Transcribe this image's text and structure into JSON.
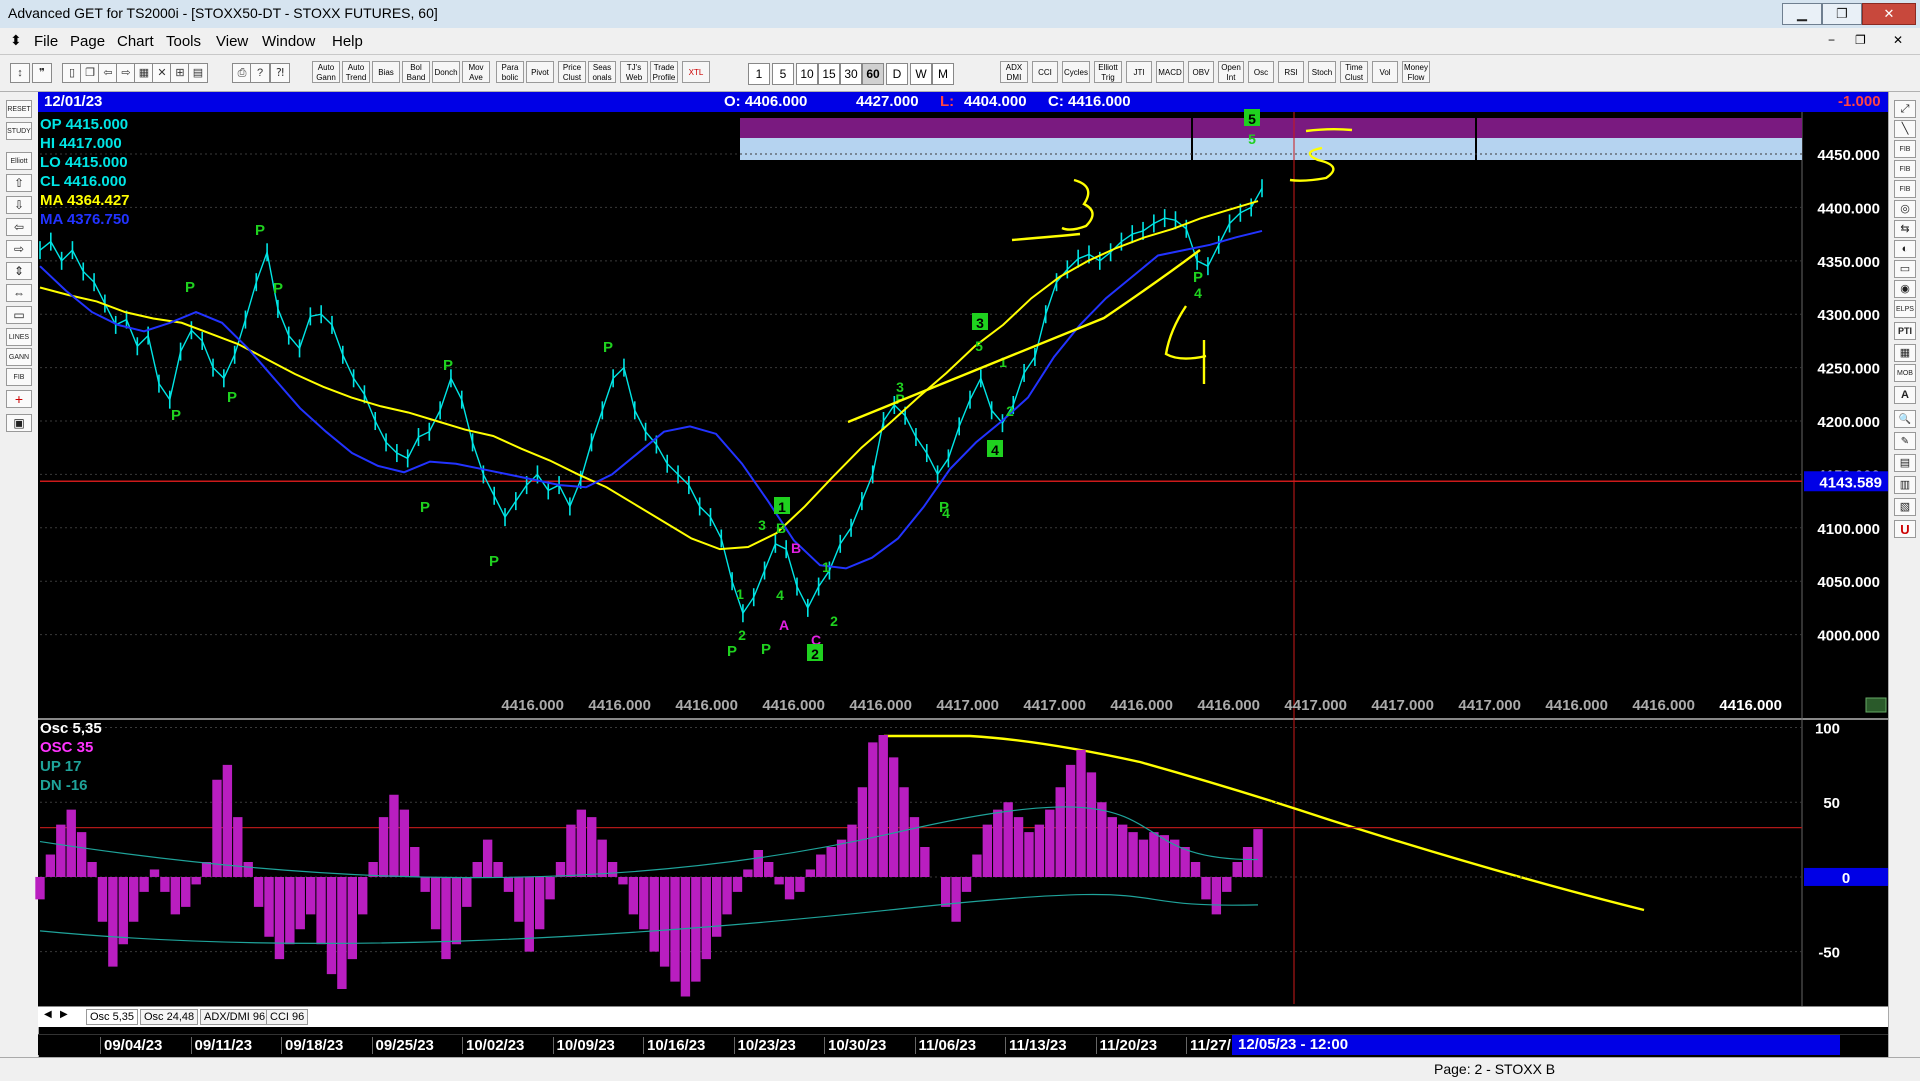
{
  "window": {
    "title": "Advanced GET for TS2000i - [STOXX50-DT - STOXX FUTURES, 60]",
    "minimize": "▁",
    "restore": "❐",
    "close": "✕",
    "mdi_min": "−",
    "mdi_restore": "❐",
    "mdi_close": "✕"
  },
  "menu": [
    "File",
    "Page",
    "Chart",
    "Tools",
    "View",
    "Window",
    "Help"
  ],
  "toolbar": {
    "study_buttons": [
      "Auto Gann",
      "Auto Trend",
      "Bias",
      "Bol Band",
      "Donch",
      "Mov Ave",
      "Para bolic",
      "Pivot",
      "Price Clust",
      "Seas onals",
      "TJ's Web",
      "Trade Profile",
      "XTL"
    ],
    "timeframes": [
      "1",
      "5",
      "10",
      "15",
      "30",
      "60",
      "D",
      "W",
      "M"
    ],
    "active_timeframe": "60",
    "indicator_buttons": [
      "ADX DMI",
      "CCI",
      "Cycles",
      "Elliott Trig",
      "JTI",
      "MACD",
      "OBV",
      "Open Int",
      "Osc",
      "RSI",
      "Stoch",
      "Time Clust",
      "Vol",
      "Money Flow"
    ]
  },
  "left_tools": [
    "RESET",
    "STUDY",
    "Elliott",
    "⇧",
    "⇩",
    "⇦",
    "⇨",
    "⇕",
    "⇔",
    "▭",
    "LINES",
    "GANN",
    "FIB",
    "+",
    "▣"
  ],
  "right_tools": [
    "⤢",
    "╲",
    "FIB RET",
    "FIB EXT",
    "FIB TIME",
    "◎",
    "⇆",
    "◐",
    "▭",
    "◉",
    "ELPS",
    "PTI",
    "▦",
    "MOB",
    "A",
    "🔍",
    "✎",
    "▤",
    "▥",
    "▧",
    "U"
  ],
  "info_bar": {
    "date": "12/01/23",
    "open": "O: 4406.000",
    "high": "4427.000",
    "low_prefix": "L:",
    "low": "4404.000",
    "close": "C: 4416.000",
    "change": "-1.000"
  },
  "readout": [
    {
      "label": "OP  4415.000",
      "color": "#00e5e5"
    },
    {
      "label": "HI   4417.000",
      "color": "#00e5e5"
    },
    {
      "label": "LO  4415.000",
      "color": "#00e5e5"
    },
    {
      "label": "CL   4416.000",
      "color": "#00e5e5"
    },
    {
      "label": "MA  4364.427",
      "color": "#ffff00"
    },
    {
      "label": "MA  4376.750",
      "color": "#2233ff"
    }
  ],
  "oscillator_readout": [
    {
      "label": "Osc 5,35",
      "color": "#ffffff"
    },
    {
      "label": "OSC 35",
      "color": "#ff33ff"
    },
    {
      "label": "UP   17",
      "color": "#1fa39a"
    },
    {
      "label": "DN   -16",
      "color": "#1fa39a"
    }
  ],
  "price_axis": {
    "ticks": [
      "4450.000",
      "4400.000",
      "4350.000",
      "4300.000",
      "4250.000",
      "4200.000",
      "4150.000",
      "4100.000",
      "4050.000",
      "4000.000"
    ],
    "current_marker": "4143.589"
  },
  "osc_axis": {
    "ticks": [
      "100",
      "50",
      "0",
      "-50"
    ]
  },
  "bottom_value_strip": [
    "4416.000",
    "4416.000",
    "4416.000",
    "4416.000",
    "4416.000",
    "4417.000",
    "4417.000",
    "4416.000",
    "4416.000",
    "4417.000",
    "4417.000",
    "4417.000",
    "4416.000",
    "4416.000",
    "4416.000"
  ],
  "tabs": [
    "Osc 5,35",
    "Osc 24,48",
    "ADX/DMI 96",
    "CCI 96"
  ],
  "tab_nav": [
    "◀",
    "▶"
  ],
  "date_axis": [
    "09/04/23",
    "09/11/23",
    "09/18/23",
    "09/25/23",
    "10/02/23",
    "10/09/23",
    "10/16/23",
    "10/23/23",
    "10/30/23",
    "11/06/23",
    "11/13/23",
    "11/20/23",
    "11/27/"
  ],
  "date_cursor": "12/05/23 - 12:00",
  "status": {
    "page": "Page: 2 - STOXX B"
  },
  "chart_data": {
    "type": "line",
    "title": "STOXX50-DT - STOXX FUTURES, 60",
    "xlabel": "",
    "ylabel": "",
    "x_range": [
      "09/04/23",
      "12/05/23"
    ],
    "ylim": [
      3950,
      4480
    ],
    "series": [
      {
        "color": "#00e5e5",
        "type": "price_bars",
        "values": [
          4360,
          4368,
          4350,
          4360,
          4340,
          4330,
          4310,
          4290,
          4295,
          4270,
          4280,
          4235,
          4220,
          4265,
          4285,
          4275,
          4250,
          4240,
          4262,
          4295,
          4330,
          4358,
          4305,
          4280,
          4268,
          4298,
          4300,
          4290,
          4262,
          4240,
          4225,
          4200,
          4180,
          4170,
          4165,
          4185,
          4190,
          4210,
          4240,
          4220,
          4180,
          4150,
          4130,
          4110,
          4125,
          4140,
          4150,
          4135,
          4140,
          4120,
          4145,
          4180,
          4210,
          4240,
          4250,
          4210,
          4190,
          4178,
          4160,
          4150,
          4140,
          4120,
          4110,
          4090,
          4050,
          4020,
          4035,
          4060,
          4085,
          4080,
          4045,
          4025,
          4045,
          4060,
          4085,
          4100,
          4125,
          4150,
          4200,
          4215,
          4205,
          4185,
          4170,
          4150,
          4165,
          4195,
          4220,
          4240,
          4210,
          4198,
          4215,
          4245,
          4260,
          4300,
          4330,
          4342,
          4352,
          4356,
          4350,
          4358,
          4368,
          4375,
          4378,
          4385,
          4390,
          4388,
          4380,
          4350,
          4345,
          4365,
          4385,
          4395,
          4400,
          4418
        ]
      },
      {
        "color": "#ffff00",
        "type": "moving_average",
        "value_label": "4364.427",
        "values": [
          4325,
          4318,
          4312,
          4302,
          4296,
          4292,
          4282,
          4272,
          4258,
          4244,
          4232,
          4222,
          4214,
          4208,
          4200,
          4192,
          4186,
          4174,
          4163,
          4150,
          4138,
          4122,
          4106,
          4090,
          4080,
          4082,
          4095,
          4120,
          4148,
          4175,
          4198,
          4222,
          4245,
          4270,
          4290,
          4315,
          4335,
          4350,
          4362,
          4372,
          4380,
          4390,
          4398,
          4406
        ]
      },
      {
        "color": "#2233ff",
        "type": "moving_average",
        "value_label": "4376.750",
        "values": [
          4345,
          4322,
          4302,
          4290,
          4284,
          4292,
          4302,
          4292,
          4268,
          4240,
          4212,
          4190,
          4170,
          4158,
          4152,
          4162,
          4160,
          4155,
          4150,
          4145,
          4140,
          4138,
          4150,
          4170,
          4190,
          4195,
          4188,
          4160,
          4125,
          4088,
          4065,
          4062,
          4072,
          4090,
          4120,
          4155,
          4180,
          4200,
          4222,
          4260,
          4290,
          4315,
          4335,
          4355,
          4360,
          4365,
          4372,
          4378
        ]
      }
    ],
    "annotations": {
      "pivots": [
        "P",
        "P",
        "P",
        "P",
        "P",
        "P",
        "P",
        "P",
        "P",
        "P",
        "P",
        "P"
      ],
      "elliott_labels": [
        "1",
        "2",
        "3",
        "4",
        "5",
        "A",
        "B",
        "C"
      ],
      "handwritten_counts": [
        "3",
        "4",
        "5"
      ]
    },
    "target_zone": {
      "low": 4435,
      "high": 4475
    },
    "oscillator": {
      "name": "Osc 5,35",
      "ylim": [
        -85,
        105
      ],
      "upper_band": 17,
      "lower_band": -16,
      "reference": 33,
      "values": [
        -15,
        15,
        35,
        45,
        30,
        10,
        -30,
        -60,
        -45,
        -30,
        -10,
        5,
        -10,
        -25,
        -20,
        -5,
        10,
        65,
        75,
        40,
        10,
        -20,
        -40,
        -55,
        -45,
        -35,
        -25,
        -45,
        -65,
        -75,
        -55,
        -25,
        10,
        40,
        55,
        45,
        20,
        -10,
        -35,
        -55,
        -45,
        -20,
        10,
        25,
        10,
        -10,
        -30,
        -50,
        -35,
        -15,
        10,
        35,
        45,
        40,
        25,
        10,
        -5,
        -25,
        -35,
        -50,
        -60,
        -70,
        -80,
        -70,
        -55,
        -40,
        -25,
        -10,
        5,
        18,
        10,
        -5,
        -15,
        -10,
        5,
        15,
        20,
        25,
        35,
        60,
        90,
        95,
        80,
        60,
        40,
        20,
        0,
        -20,
        -30,
        -10,
        15,
        35,
        45,
        50,
        40,
        30,
        35,
        45,
        60,
        75,
        85,
        70,
        50,
        40,
        35,
        30,
        25,
        30,
        28,
        25,
        20,
        10,
        -15,
        -25,
        -10,
        10,
        20,
        32
      ]
    }
  }
}
